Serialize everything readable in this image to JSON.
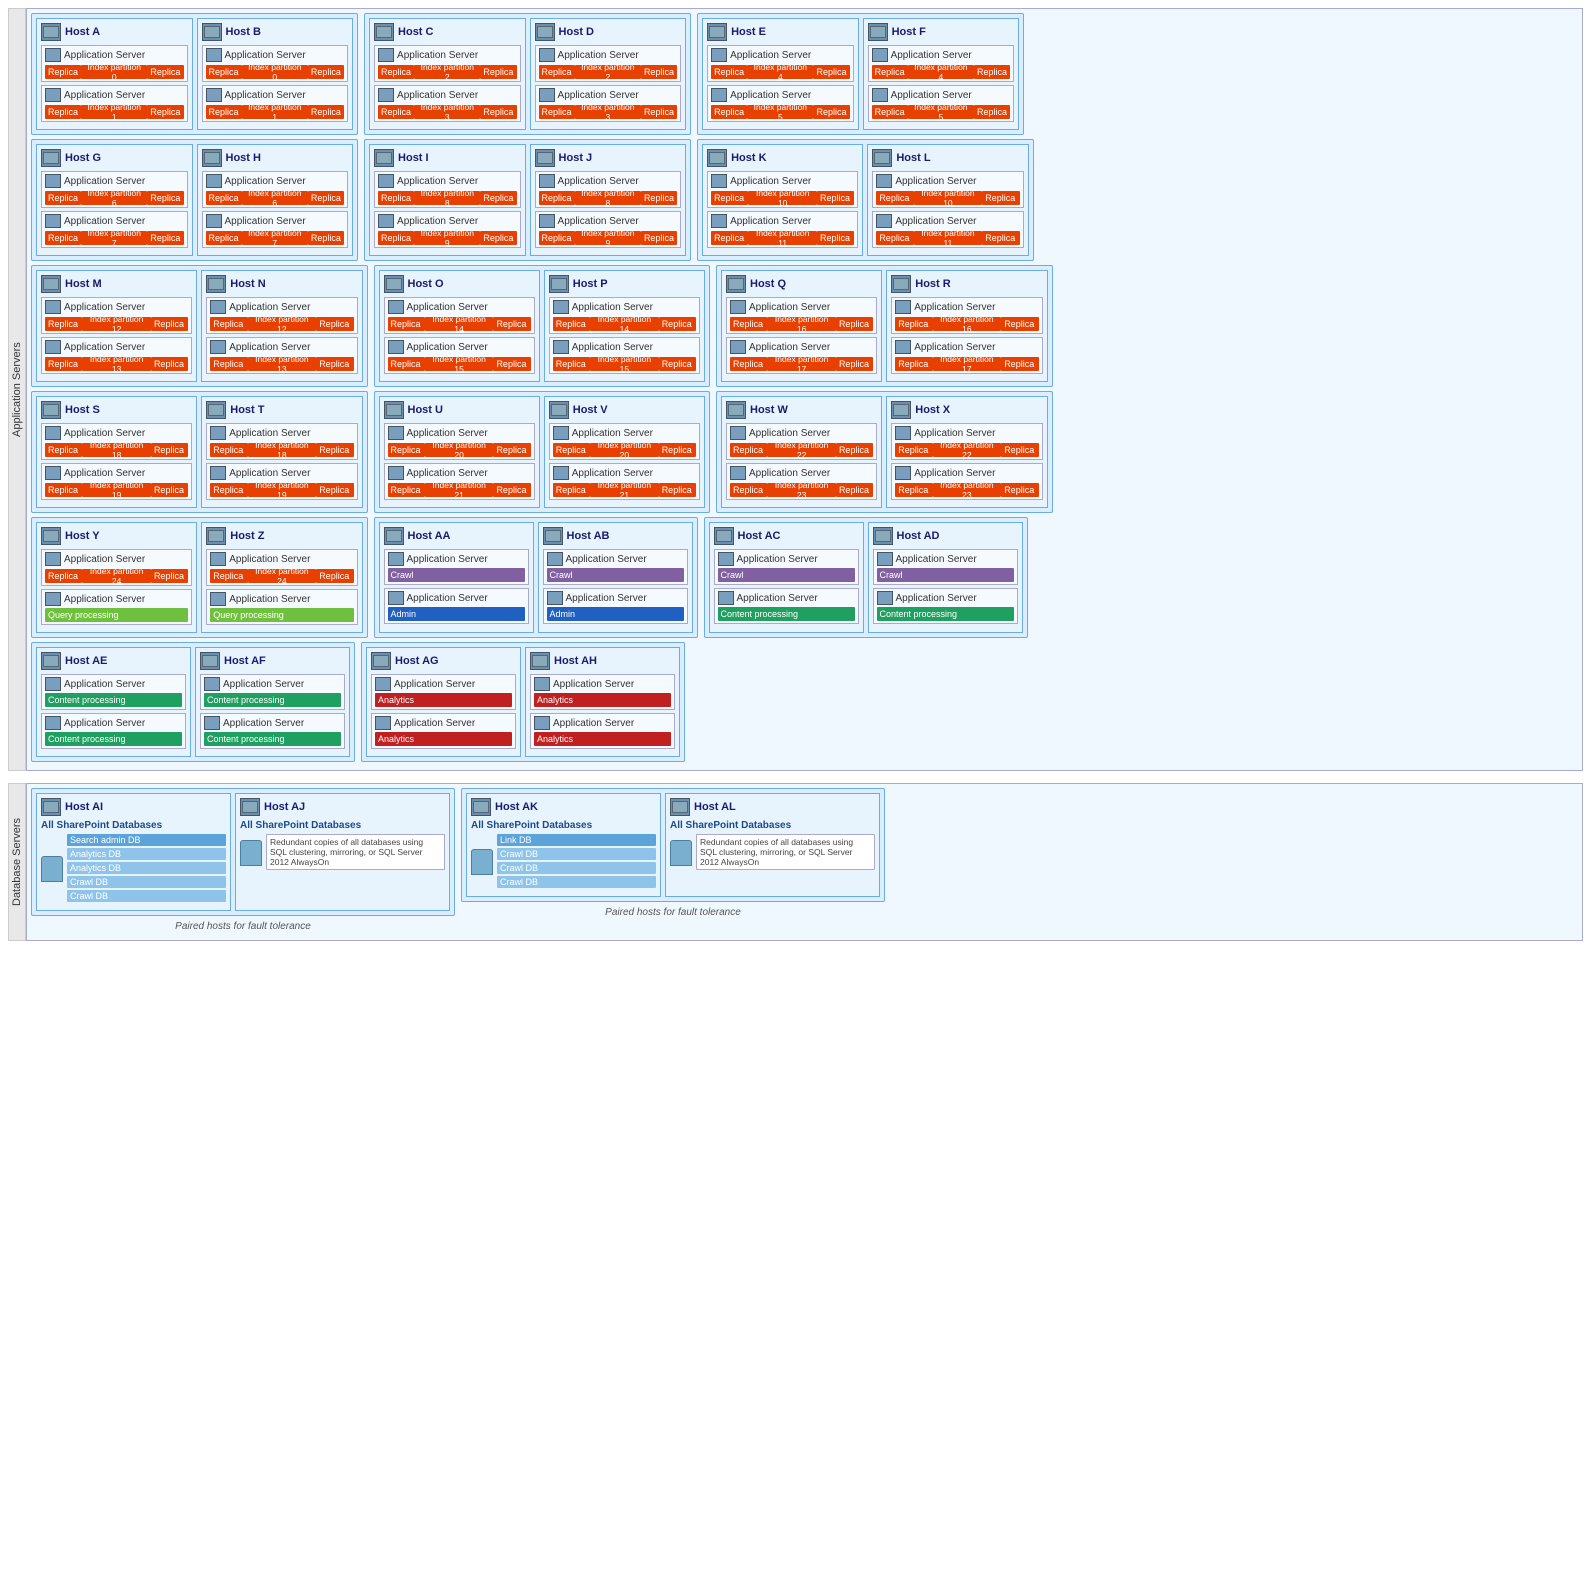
{
  "sections": {
    "app_servers_label": "Application Servers",
    "db_servers_label": "Database Servers"
  },
  "rows": [
    {
      "id": "row1",
      "pairs": [
        {
          "hosts": [
            {
              "name": "Host A",
              "servers": [
                {
                  "label": "Application Server",
                  "services": [
                    {
                      "type": "replica_index",
                      "index": "Index partition 0"
                    }
                  ]
                }
              ]
            },
            {
              "name": "Host B",
              "servers": [
                {
                  "label": "Application Server",
                  "services": [
                    {
                      "type": "replica_index",
                      "index": "Index partition 0"
                    }
                  ]
                }
              ]
            }
          ]
        },
        {
          "hosts": [
            {
              "name": "Host A",
              "extra_servers": [
                {
                  "label": "Application Server",
                  "services": [
                    {
                      "type": "replica_index",
                      "index": "Index partition 1"
                    }
                  ]
                }
              ]
            },
            {
              "name": "Host B",
              "extra_servers": [
                {
                  "label": "Application Server",
                  "services": [
                    {
                      "type": "replica_index",
                      "index": "Index partition 1"
                    }
                  ]
                }
              ]
            }
          ]
        }
      ]
    }
  ],
  "all_rows": [
    [
      {
        "hostA": "Host A",
        "hostB": "Host B",
        "idx0": "Index partition 0",
        "idx1": "Index partition 1"
      },
      {
        "hostA": "Host C",
        "hostB": "Host D",
        "idx0": "Index partition 2",
        "idx1": "Index partition 3"
      },
      {
        "hostA": "Host E",
        "hostB": "Host F",
        "idx0": "Index partition 4",
        "idx1": "Index partition 5"
      }
    ],
    [
      {
        "hostA": "Host G",
        "hostB": "Host H",
        "idx0": "Index partition 6",
        "idx1": "Index partition 7"
      },
      {
        "hostA": "Host I",
        "hostB": "Host J",
        "idx0": "Index partition 8",
        "idx1": "Index partition 9"
      },
      {
        "hostA": "Host K",
        "hostB": "Host L",
        "idx0": "Index partition 10",
        "idx1": "Index partition 11"
      }
    ],
    [
      {
        "hostA": "Host M",
        "hostB": "Host N",
        "idx0": "Index partition 12",
        "idx1": "Index partition 13"
      },
      {
        "hostA": "Host O",
        "hostB": "Host P",
        "idx0": "Index partition 14",
        "idx1": "Index partition 15"
      },
      {
        "hostA": "Host Q",
        "hostB": "Host R",
        "idx0": "Index partition 16",
        "idx1": "Index partition 17"
      }
    ],
    [
      {
        "hostA": "Host S",
        "hostB": "Host T",
        "idx0": "Index partition 18",
        "idx1": "Index partition 19"
      },
      {
        "hostA": "Host U",
        "hostB": "Host V",
        "idx0": "Index partition 20",
        "idx1": "Index partition 21"
      },
      {
        "hostA": "Host W",
        "hostB": "Host X",
        "idx0": "Index partition 22",
        "idx1": "Index partition 23"
      }
    ]
  ],
  "special_row": [
    {
      "hostA": "Host Y",
      "hostB": "Host Z",
      "idx0": "Index partition 24",
      "service_y2": "Query processing",
      "service_z2": "Query processing"
    },
    {
      "hostA": "Host AA",
      "hostB": "Host AB",
      "service_a1": "Crawl",
      "service_a2": "Admin",
      "service_b1": "Crawl",
      "service_b2": "Admin"
    },
    {
      "hostA": "Host AC",
      "hostB": "Host AD",
      "service_a1": "Crawl",
      "service_a2": "Content processing",
      "service_b1": "Crawl",
      "service_b2": "Content processing"
    }
  ],
  "content_row": [
    {
      "hostA": "Host AE",
      "hostB": "Host AF",
      "service_a1": "Content processing",
      "service_a2": "Content processing",
      "service_b1": "Content processing",
      "service_b2": "Content processing"
    },
    {
      "hostA": "Host AG",
      "hostB": "Host AH",
      "service_a1": "Analytics",
      "service_a2": "Analytics",
      "service_b1": "Analytics",
      "service_b2": "Analytics"
    }
  ],
  "db_rows": [
    {
      "pairLabel": "Paired hosts for fault tolerance",
      "pairs": [
        {
          "hostA": "Host AI",
          "hostB": "Host AJ",
          "dbLabel": "All SharePoint Databases",
          "dbsA": [
            "Search admin DB",
            "Analytics DB",
            "Analytics DB",
            "Crawl DB",
            "Crawl DB"
          ],
          "dbsB_text": "Redundant copies of all databases using SQL clustering, mirroring, or SQL Server 2012 AlwaysOn"
        },
        {
          "hostA": "Host AK",
          "hostB": "Host AL",
          "dbLabel": "All SharePoint Databases",
          "dbsA": [
            "Link DB",
            "Crawl DB",
            "Crawl DB",
            "Crawl DB"
          ],
          "dbsB_text": "Redundant copies of all databases using SQL clustering, mirroring, or SQL Server 2012 AlwaysOn"
        }
      ]
    }
  ],
  "labels": {
    "app_server": "Application Server",
    "replica": "Replica",
    "query_processing": "Query processing",
    "crawl": "Crawl",
    "admin": "Admin",
    "content_processing": "Content processing",
    "analytics": "Analytics",
    "all_sp_db": "All SharePoint Databases",
    "paired_fault": "Paired hosts for fault tolerance"
  }
}
